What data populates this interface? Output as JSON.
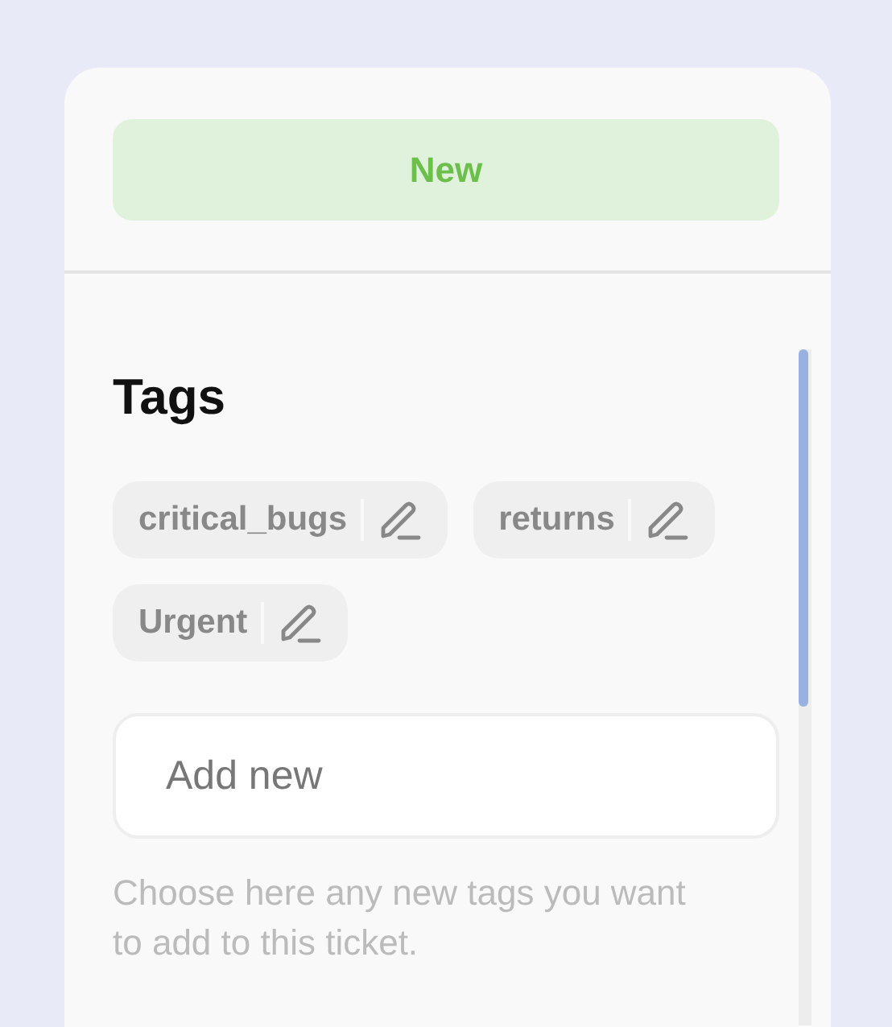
{
  "status": {
    "label": "New"
  },
  "tags_section": {
    "title": "Tags",
    "tags": [
      {
        "label": "critical_bugs"
      },
      {
        "label": "returns"
      },
      {
        "label": "Urgent"
      }
    ],
    "add_field": {
      "placeholder": "Add new"
    },
    "hint": "Choose here any new tags you want to add to this ticket."
  }
}
